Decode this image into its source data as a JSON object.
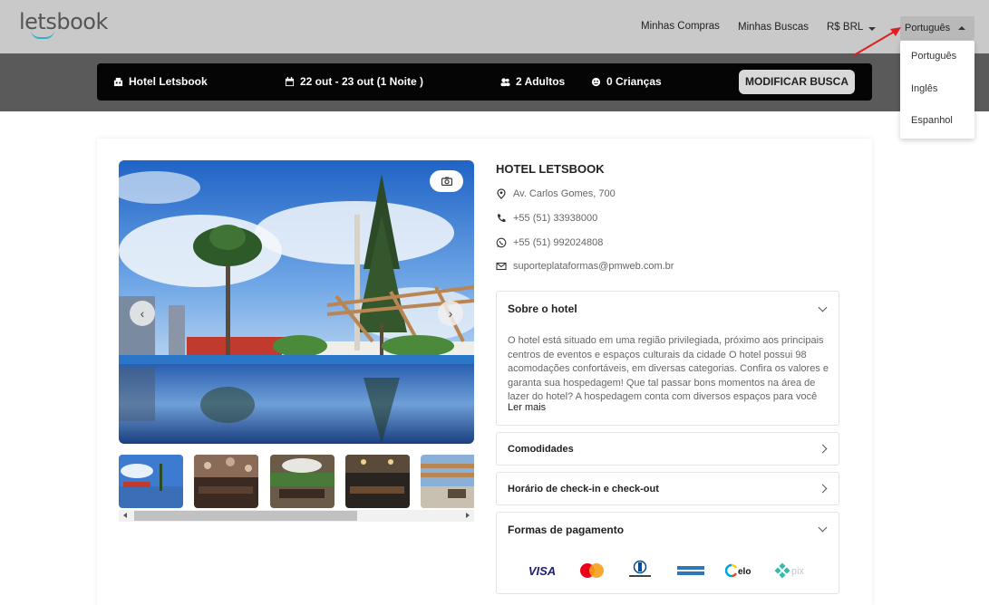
{
  "header": {
    "logo": "letsbook",
    "nav": [
      "Minhas Compras",
      "Minhas Buscas"
    ],
    "currency": "R$ BRL",
    "language": "Português",
    "language_options": [
      "Português",
      "Inglês",
      "Espanhol"
    ]
  },
  "search": {
    "hotel": "Hotel Letsbook",
    "dates": "22 out - 23 out (1 Noite )",
    "adults": "2 Adultos",
    "children": "0 Crianças",
    "modify_label": "MODIFICAR BUSCA"
  },
  "hotel": {
    "name": "HOTEL LETSBOOK",
    "address": "Av. Carlos Gomes, 700",
    "phone": "+55 (51) 33938000",
    "whatsapp": "+55 (51) 992024808",
    "email": "suporteplataformas@pmweb.com.br"
  },
  "sections": {
    "about_title": "Sobre o hotel",
    "about_text": "O hotel está situado em uma região privilegiada, próximo aos principais centros de eventos e espaços culturais da cidade O hotel possui 98 acomodações confortáveis, em diversas categorias. Confira os valores e garanta sua hospedagem! Que tal passar bons momentos na área de lazer do hotel? A hospedagem conta com diversos espaços para você recarreg...",
    "read_more": "Ler mais",
    "amenities_title": "Comodidades",
    "checkin_title": "Horário de check-in e check-out",
    "payment_title": "Formas de pagamento",
    "payment_methods": [
      "VISA",
      "Mastercard",
      "Diners Club",
      "American Express",
      "elo",
      "pix"
    ]
  },
  "colors": {
    "accent_teal": "#31b0c7",
    "searchbar": "#050505",
    "arrow_red": "#e02020"
  }
}
